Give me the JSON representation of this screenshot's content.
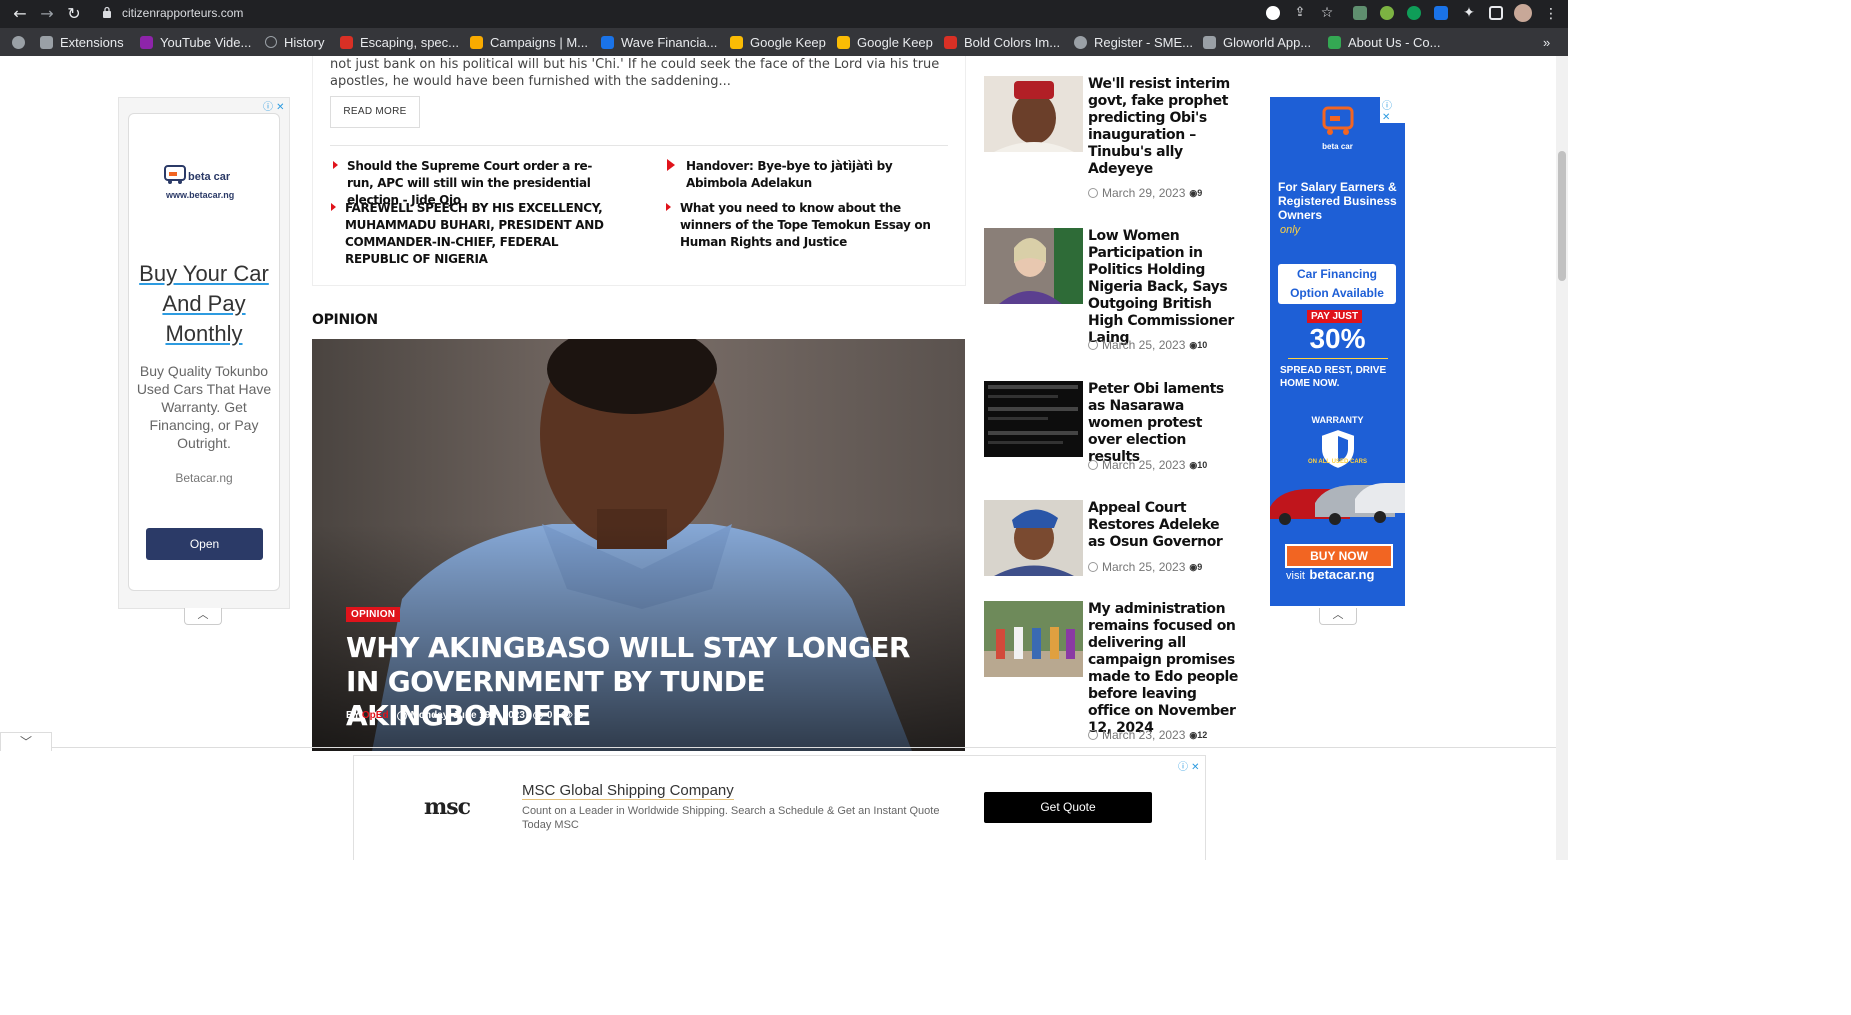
{
  "browser": {
    "url": "citizenrapporteurs.com",
    "bookmarks": [
      {
        "label": "Extensions",
        "color": "#9aa0a6"
      },
      {
        "label": "YouTube Vide...",
        "color": "#8e24aa"
      },
      {
        "label": "History",
        "color": "#9aa0a6"
      },
      {
        "label": "Escaping, spec...",
        "color": "#d93025"
      },
      {
        "label": "Campaigns | M...",
        "color": "#f9ab00"
      },
      {
        "label": "Wave Financia...",
        "color": "#1a73e8"
      },
      {
        "label": "Google Keep",
        "color": "#fbbc04"
      },
      {
        "label": "Google Keep",
        "color": "#fbbc04"
      },
      {
        "label": "Bold Colors Im...",
        "color": "#d93025"
      },
      {
        "label": "Register - SME...",
        "color": "#9aa0a6"
      },
      {
        "label": "Gloworld App...",
        "color": "#9aa0a6"
      },
      {
        "label": "About Us - Co...",
        "color": "#34a853"
      }
    ]
  },
  "left_ad": {
    "brand": "beta car",
    "site": "www.betacar.ng",
    "headline": "Buy Your Car And Pay Monthly",
    "body": "Buy Quality Tokunbo Used Cars That Have Warranty. Get Financing, or Pay Outright.",
    "domain": "Betacar.ng",
    "button": "Open",
    "close": "ⓘ ✕"
  },
  "main": {
    "excerpt": "not just bank on his political will but his 'Chi.' If he could seek the face of the Lord via his true apostles, he would have been furnished with the saddening...",
    "read_more": "READ MORE",
    "related": [
      "Should the Supreme Court order a re-run, APC will still win the presidential election - Jide Ojo",
      "Handover: Bye-bye to jàtìjàtì by Abimbola Adelakun",
      "FAREWELL SPEECH BY HIS EXCELLENCY, MUHAMMADU BUHARI, PRESIDENT AND COMMANDER-IN-CHIEF, FEDERAL REPUBLIC OF NIGERIA",
      "What you need to know about the winners of the Tope Temokun Essay on Human Rights and Justice"
    ],
    "section_title": "OPINION",
    "hero": {
      "tag": "OPINION",
      "headline": "WHY AKINGBASO WILL STAY LONGER IN GOVERNMENT BY TUNDE AKINGBONDERE",
      "by": "BY",
      "author": "OpEd",
      "date": "Monday, June 19th 2023",
      "comments": "0",
      "views": "16"
    }
  },
  "sidebar": [
    {
      "title": "We'll resist interim govt, fake prophet predicting Obi's inauguration – Tinubu's ally Adeyeye",
      "date": "March 29, 2023",
      "views": "9"
    },
    {
      "title": "Low Women Participation in Politics Holding Nigeria Back, Says Outgoing British High Commissioner Laing",
      "date": "March 25, 2023",
      "views": "10"
    },
    {
      "title": "Peter Obi laments as Nasarawa women protest over election results",
      "date": "March 25, 2023",
      "views": "10"
    },
    {
      "title": "Appeal Court Restores Adeleke as Osun Governor",
      "date": "March 25, 2023",
      "views": "9"
    },
    {
      "title": "My administration remains focused on delivering all campaign promises made to Edo people before leaving office on November 12, 2024",
      "date": "March 23, 2023",
      "views": "12"
    }
  ],
  "right_ad": {
    "brand": "beta car",
    "line1": "For Salary Earners & Registered Business Owners",
    "only": "only",
    "financing": "Car Financing Option Available",
    "pay_just": "PAY JUST",
    "percent": "30%",
    "spread": "SPREAD REST, DRIVE HOME NOW.",
    "warranty": "WARRANTY",
    "warranty_sub": "ON ALL USED CARS",
    "buy": "BUY NOW",
    "visit": "visit",
    "site": "betacar.ng"
  },
  "bottom_ad": {
    "title": "MSC Global Shipping Company",
    "body": "Count on a Leader in Worldwide Shipping. Search a Schedule & Get an Instant Quote Today MSC",
    "button": "Get Quote",
    "logo": "msc"
  },
  "colors": {
    "accent": "#e0131b",
    "chrome": "#202124",
    "ad_blue": "#1e5fd6",
    "ad_navy": "#2b3a67"
  }
}
